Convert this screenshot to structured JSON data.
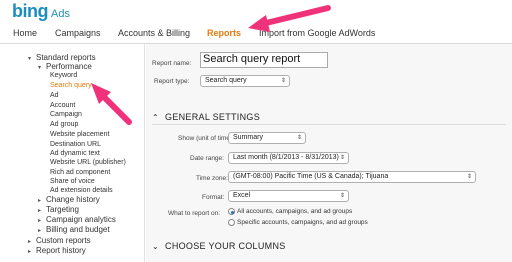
{
  "brand": {
    "name": "bing",
    "product": "Ads"
  },
  "nav": {
    "items": [
      {
        "label": "Home",
        "active": false
      },
      {
        "label": "Campaigns",
        "active": false
      },
      {
        "label": "Accounts & Billing",
        "active": false
      },
      {
        "label": "Reports",
        "active": true
      },
      {
        "label": "Import from Google AdWords",
        "active": false
      }
    ]
  },
  "sidebar": {
    "standard_reports": "Standard reports",
    "performance": "Performance",
    "performance_items": [
      "Keyword",
      "Search query",
      "Ad",
      "Account",
      "Campaign",
      "Ad group",
      "Website placement",
      "Destination URL",
      "Ad dynamic text",
      "Website URL (publisher)",
      "Rich ad component",
      "Share of voice",
      "Ad extension details"
    ],
    "active_item": "Search query",
    "other_groups": [
      "Change history",
      "Targeting",
      "Campaign analytics",
      "Billing and budget"
    ],
    "custom_reports": "Custom reports",
    "report_history": "Report history"
  },
  "form": {
    "report_name_label": "Report name:",
    "report_name_value": "Search query report",
    "report_type_label": "Report type:",
    "report_type_value": "Search query",
    "general_settings": "GENERAL SETTINGS",
    "show_label": "Show (unit of time):",
    "show_value": "Summary",
    "date_range_label": "Date range:",
    "date_range_value": "Last month (8/1/2013 - 8/31/2013)",
    "time_zone_label": "Time zone:",
    "time_zone_value": "(GMT-08:00) Pacific Time (US & Canada); Tijuana",
    "format_label": "Format:",
    "format_value": "Excel",
    "what_to_report_label": "What to report on:",
    "report_on_options": [
      {
        "label": "All accounts, campaigns, and ad groups",
        "selected": true
      },
      {
        "label": "Specific accounts, campaigns, and ad groups",
        "selected": false
      }
    ],
    "choose_columns": "CHOOSE YOUR COLUMNS"
  },
  "colors": {
    "accent": "#e87a0e",
    "brand_blue": "#1d8ebc",
    "annotation_pink": "#f0327a"
  }
}
